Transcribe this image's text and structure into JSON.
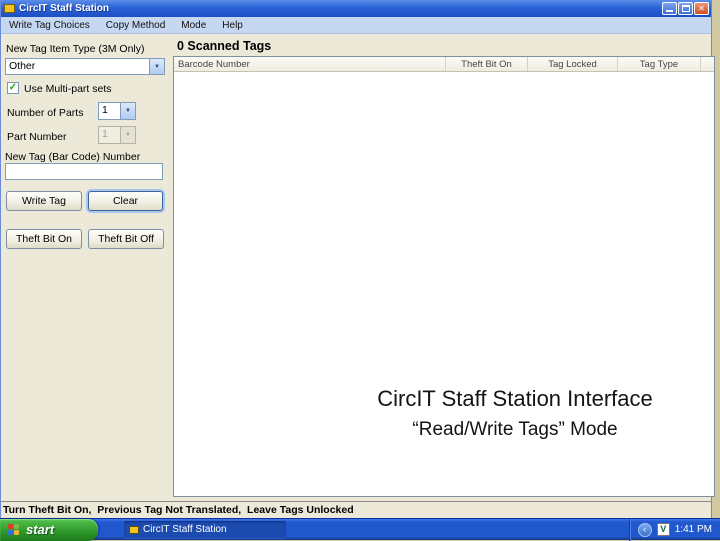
{
  "icons": {
    "close": "✕",
    "dropdown_arrow": "▼",
    "checkmark": "✓",
    "tray_chevron": "‹",
    "tray_app": "V"
  },
  "colors": {
    "titlebar_blue": "#2A63D8",
    "window_face": "#ECE9D8",
    "taskbar_blue": "#2157CD",
    "start_green": "#2F9A2B",
    "list_background": "#FFFFFF"
  },
  "window": {
    "title": "CircIT Staff Station",
    "menu": [
      "Write Tag Choices",
      "Copy Method",
      "Mode",
      "Help"
    ]
  },
  "panel": {
    "item_type_label": "New Tag Item Type (3M Only)",
    "item_type_value": "Other",
    "multipart_label": "Use Multi-part sets",
    "parts_label": "Number of Parts",
    "parts_value": "1",
    "part_number_label": "Part Number",
    "part_number_value": "1",
    "new_tag_label": "New Tag (Bar Code) Number",
    "new_tag_value": "",
    "write_tag_button": "Write Tag",
    "clear_button": "Clear",
    "theft_on_button": "Theft Bit On",
    "theft_off_button": "Theft Bit Off"
  },
  "main": {
    "heading": "0 Scanned Tags",
    "columns": [
      "Barcode Number",
      "Theft Bit On",
      "Tag Locked",
      "Tag Type"
    ],
    "rows": []
  },
  "overlay": {
    "title": "CircIT Staff Station Interface",
    "subtitle": "“Read/Write Tags” Mode"
  },
  "statusbar": {
    "text": "Turn Theft Bit On,  Previous Tag Not Translated,  Leave Tags Unlocked"
  },
  "taskbar": {
    "start_label": "start",
    "task_label": "CircIT Staff Station",
    "time": "1:41 PM"
  }
}
